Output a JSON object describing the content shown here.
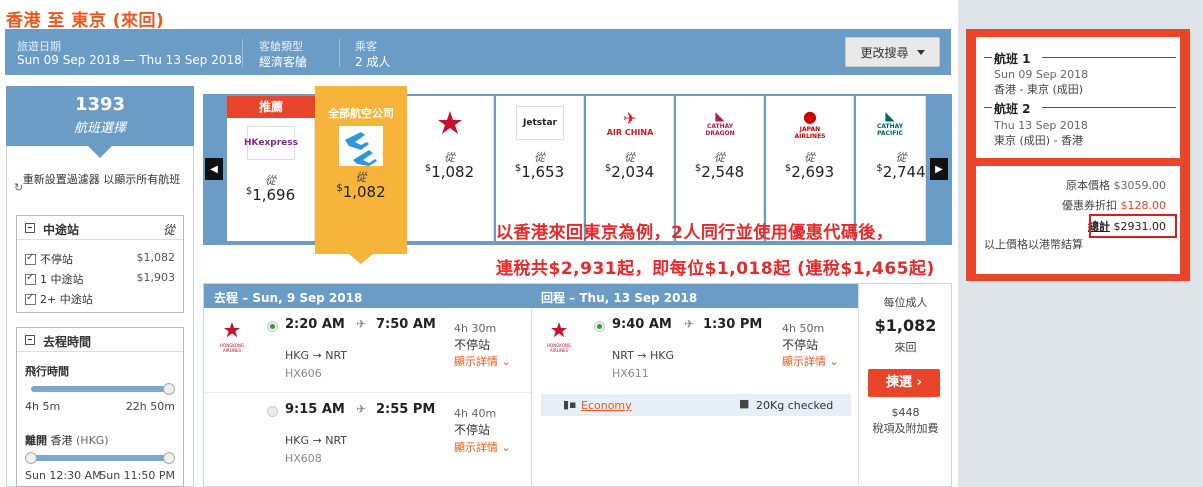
{
  "page": {
    "title": "香港 至 東京 (來回)"
  },
  "search_bar": {
    "dates_label": "旅遊日期",
    "dates_value": "Sun 09 Sep 2018 — Thu 13 Sep 2018",
    "cabin_label": "客艙類型",
    "cabin_value": "經濟客艙",
    "pax_label": "乘客",
    "pax_value": "2 成人",
    "modify_label": "更改搜尋"
  },
  "filters": {
    "count": "1393",
    "count_label": "航班選擇",
    "reset_label": "重新設置過濾器 以顯示所有航班",
    "stops": {
      "title": "中途站",
      "header_right": "從",
      "items": [
        {
          "label": "不停站",
          "price": "$1,082"
        },
        {
          "label": "1 中途站",
          "price": "$1,903"
        },
        {
          "label": "2+ 中途站",
          "price": ""
        }
      ]
    },
    "outbound_time": {
      "title": "去程時間",
      "flight_time_label": "飛行時間",
      "flight_min": "4h 5m",
      "flight_max": "22h 50m",
      "depart_label": "離開",
      "depart_city": "香港",
      "depart_code": "(HKG)",
      "depart_min": "Sun 12:30 AM",
      "depart_max": "Sun 11:50 PM"
    }
  },
  "carousel": {
    "featured_badge": "推薦",
    "all_airlines_label": "全部航空公司",
    "from_label": "從",
    "cards": [
      {
        "logo": "HKexpress",
        "price": "1,696",
        "color": "#7b2d8b"
      },
      {
        "logo": "all-airlines",
        "price": "1,082",
        "color": "#f6b43a"
      },
      {
        "logo": "HONGKONG AIRLINES",
        "price": "1,082",
        "color": "#c8102e"
      },
      {
        "logo": "Jetstar",
        "price": "1,653",
        "color": "#f47920"
      },
      {
        "logo": "AIR CHINA",
        "price": "2,034",
        "color": "#d71920"
      },
      {
        "logo": "CATHAY DRAGON",
        "price": "2,548",
        "color": "#b71c3c"
      },
      {
        "logo": "JAPAN AIRLINES",
        "price": "2,693",
        "color": "#cc0000"
      },
      {
        "logo": "CATHAY PACIFIC",
        "price": "2,744",
        "color": "#006564"
      }
    ]
  },
  "promo": {
    "line1": "以香港來回東京為例，2人同行並使用優惠代碼後，",
    "line2": "連稅共$2,931起，即每位$1,018起 (連稅$1,465起)"
  },
  "results": {
    "outbound_header": "去程 – Sun, 9 Sep 2018",
    "return_header": "回程 – Thu, 13 Sep 2018",
    "airline_logo_text": "HONGKONG AIRLINES",
    "outbound": [
      {
        "dep": "2:20 AM",
        "arr": "7:50 AM",
        "duration": "4h 30m",
        "stops": "不停站",
        "details": "顯示詳情",
        "route": "HKG → NRT",
        "code": "HX606"
      },
      {
        "dep": "9:15 AM",
        "arr": "2:55 PM",
        "duration": "4h 40m",
        "stops": "不停站",
        "details": "顯示詳情",
        "route": "HKG → NRT",
        "code": "HX608"
      }
    ],
    "return": [
      {
        "dep": "9:40 AM",
        "arr": "1:30 PM",
        "duration": "4h 50m",
        "stops": "不停站",
        "details": "顯示詳情",
        "route": "NRT → HKG",
        "code": "HX611"
      }
    ],
    "cabin_class": "Economy",
    "baggage": "20Kg checked",
    "per_adult_label": "每位成人",
    "per_adult_price": "$1,082",
    "trip_type": "來回",
    "select_label": "揀選",
    "tax_amount": "$448",
    "tax_label": "稅項及附加費"
  },
  "summary": {
    "leg1_title": "航班 1",
    "leg1_date": "Sun 09 Sep 2018",
    "leg1_route": "香港 - 東京 (成田)",
    "leg2_title": "航班 2",
    "leg2_date": "Thu 13 Sep 2018",
    "leg2_route": "東京 (成田) - 香港",
    "original_label": "原本價格",
    "original_value": "$3059.00",
    "discount_label": "優惠券折扣",
    "discount_value": "$128.00",
    "total_label": "總計",
    "total_value": "$2931.00",
    "currency_note": "以上價格以港幣結算"
  }
}
